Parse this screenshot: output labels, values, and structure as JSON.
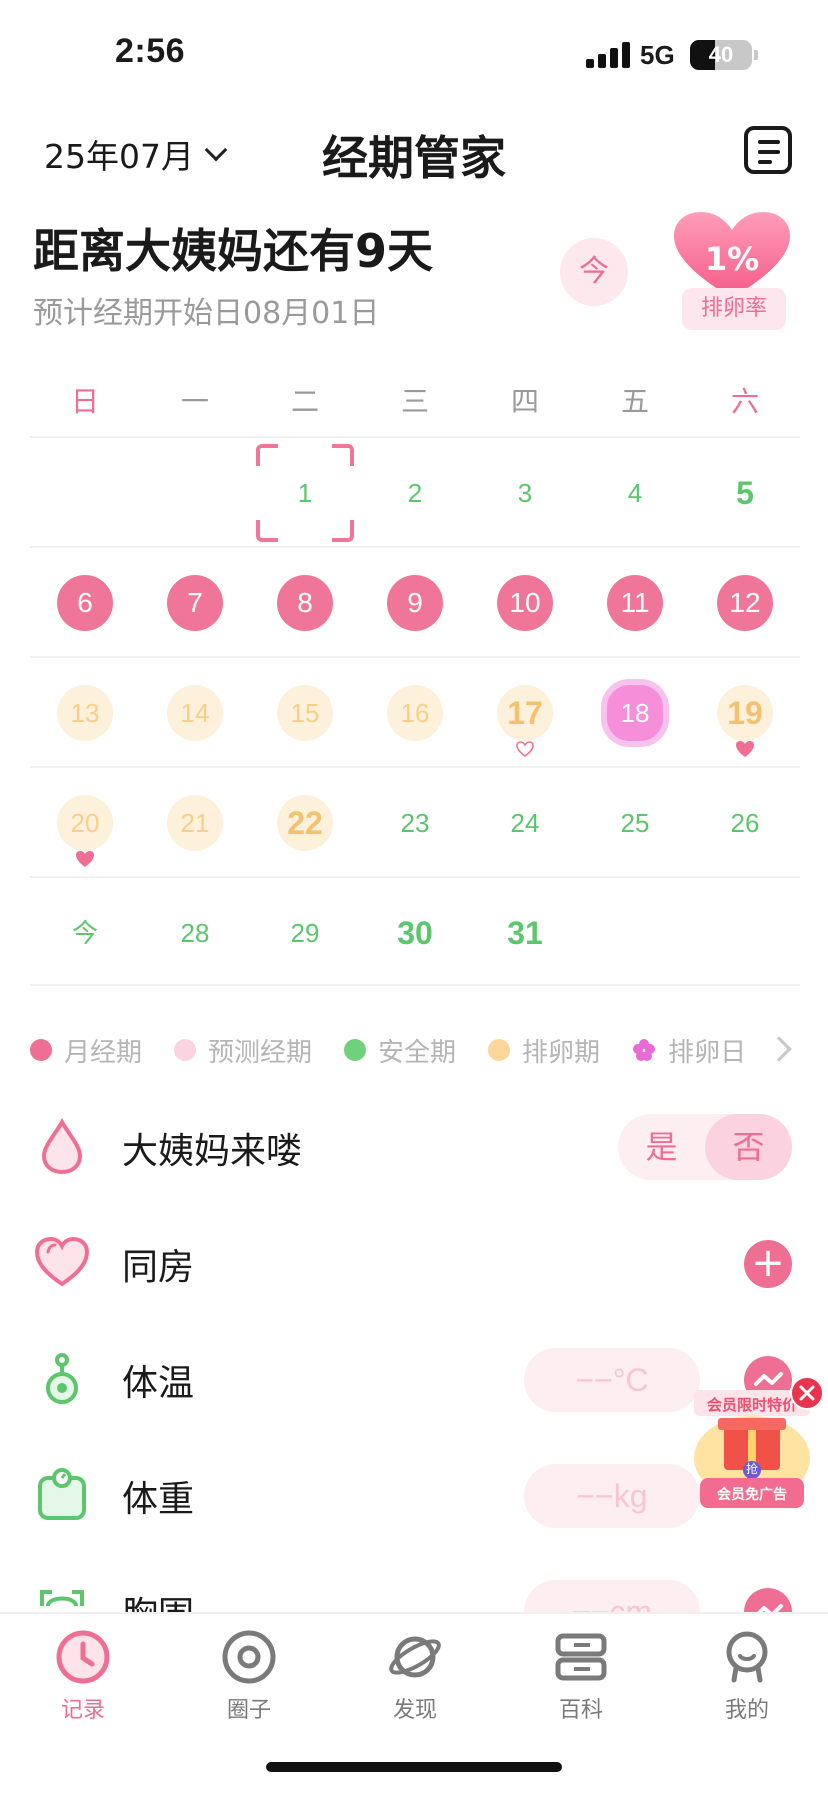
{
  "status_bar": {
    "time": "2:56",
    "network": "5G",
    "battery": "40"
  },
  "header": {
    "month": "25年07月",
    "title": "经期管家"
  },
  "summary": {
    "countdown": "距离大姨妈还有9天",
    "expected_start": "预计经期开始日08月01日",
    "today_button": "今",
    "ovulation_rate": "1%",
    "ovulation_rate_label": "排卵率"
  },
  "calendar": {
    "weekdays": [
      "日",
      "一",
      "二",
      "三",
      "四",
      "五",
      "六"
    ],
    "rows": [
      [
        {
          "d": ""
        },
        {
          "d": ""
        },
        {
          "d": "1",
          "t": "safe",
          "sel": true
        },
        {
          "d": "2",
          "t": "safe"
        },
        {
          "d": "3",
          "t": "safe"
        },
        {
          "d": "4",
          "t": "safe"
        },
        {
          "d": "5",
          "t": "safe-bold"
        }
      ],
      [
        {
          "d": "6",
          "t": "period"
        },
        {
          "d": "7",
          "t": "period"
        },
        {
          "d": "8",
          "t": "period"
        },
        {
          "d": "9",
          "t": "period"
        },
        {
          "d": "10",
          "t": "period"
        },
        {
          "d": "11",
          "t": "period"
        },
        {
          "d": "12",
          "t": "period"
        }
      ],
      [
        {
          "d": "13",
          "t": "ovu"
        },
        {
          "d": "14",
          "t": "ovu"
        },
        {
          "d": "15",
          "t": "ovu"
        },
        {
          "d": "16",
          "t": "ovu"
        },
        {
          "d": "17",
          "t": "ovu-bold",
          "mark": "outline"
        },
        {
          "d": "18",
          "t": "ovday"
        },
        {
          "d": "19",
          "t": "ovu-bold",
          "mark": "filled"
        }
      ],
      [
        {
          "d": "20",
          "t": "ovu",
          "mark": "filled"
        },
        {
          "d": "21",
          "t": "ovu"
        },
        {
          "d": "22",
          "t": "ovu-bold"
        },
        {
          "d": "23",
          "t": "safe"
        },
        {
          "d": "24",
          "t": "safe"
        },
        {
          "d": "25",
          "t": "safe"
        },
        {
          "d": "26",
          "t": "safe"
        }
      ],
      [
        {
          "d": "今",
          "t": "today"
        },
        {
          "d": "28",
          "t": "safe"
        },
        {
          "d": "29",
          "t": "safe"
        },
        {
          "d": "30",
          "t": "safe-bold"
        },
        {
          "d": "31",
          "t": "safe-bold"
        },
        {
          "d": ""
        },
        {
          "d": ""
        }
      ]
    ]
  },
  "legend": [
    {
      "label": "月经期",
      "color": "#ef6f94",
      "shape": "dot"
    },
    {
      "label": "预测经期",
      "color": "#fcd3e0",
      "shape": "dot"
    },
    {
      "label": "安全期",
      "color": "#6fd27b",
      "shape": "dot"
    },
    {
      "label": "排卵期",
      "color": "#fdd79a",
      "shape": "dot"
    },
    {
      "label": "排卵日",
      "color": "#e86bd6",
      "shape": "flower"
    }
  ],
  "records": {
    "period": {
      "label": "大姨妈来喽",
      "yes": "是",
      "no": "否",
      "selected": "否"
    },
    "intimacy": {
      "label": "同房",
      "action": "+"
    },
    "temperature": {
      "label": "体温",
      "placeholder": "−−°C"
    },
    "weight": {
      "label": "体重",
      "placeholder": "−−kg"
    },
    "bust": {
      "label": "胸围",
      "placeholder": "−−cm"
    }
  },
  "promo": {
    "title": "会员限时特价",
    "badge": "抢",
    "button": "会员免广告"
  },
  "tabs": [
    {
      "label": "记录",
      "icon": "clock-icon",
      "active": true
    },
    {
      "label": "圈子",
      "icon": "circle-icon",
      "active": false
    },
    {
      "label": "发现",
      "icon": "planet-icon",
      "active": false
    },
    {
      "label": "百科",
      "icon": "book-icon",
      "active": false
    },
    {
      "label": "我的",
      "icon": "profile-icon",
      "active": false
    }
  ],
  "colors": {
    "accent": "#ef6f94",
    "safe": "#5cc66d",
    "ovulation": "#fdf1dc",
    "ovulation_day": "#f78ed9"
  }
}
